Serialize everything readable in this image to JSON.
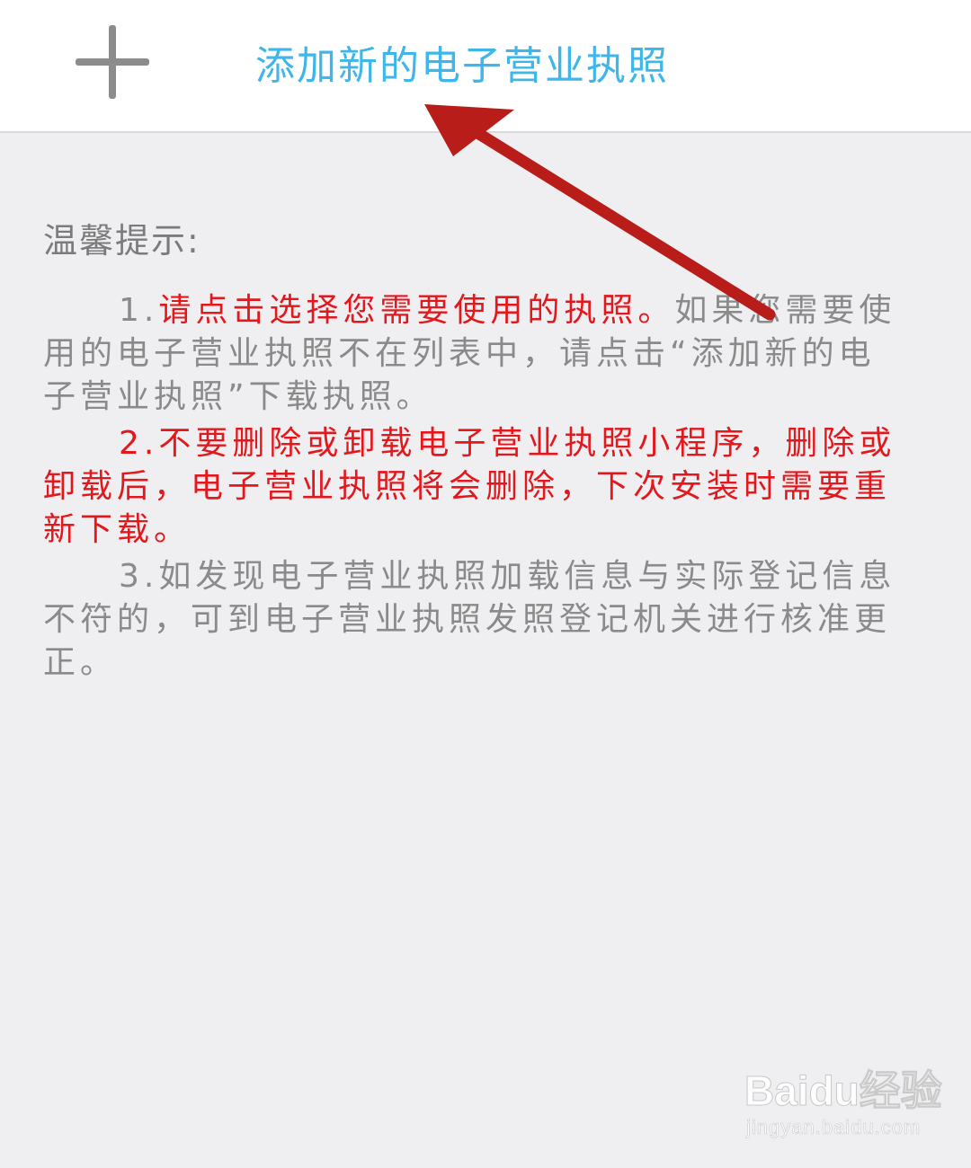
{
  "header": {
    "add_icon": "plus-icon",
    "title": "添加新的电子营业执照",
    "title_color": "#3fb6ea"
  },
  "tips": {
    "heading": "温馨提示:",
    "item1": {
      "number": "1.",
      "highlight": "请点击选择您需要使用的执照。",
      "rest": "如果您需要使用的电子营业执照不在列表中，请点击“添加新的电子营业执照”下载执照。"
    },
    "item2": {
      "text": "2.不要删除或卸载电子营业执照小程序，删除或卸载后，电子营业执照将会删除，下次安装时需要重新下载。"
    },
    "item3": {
      "text": "3.如发现电子营业执照加载信息与实际登记信息不符的，可到电子营业执照发照登记机关进行核准更正。"
    }
  },
  "annotation": {
    "arrow_color": "#b81d1a"
  },
  "watermark": {
    "logo": "Baidu经验",
    "url": "jingyan.baidu.com"
  },
  "colors": {
    "background": "#efeef1",
    "gray_text": "#8a8a8a",
    "red_text": "#e3181d"
  }
}
